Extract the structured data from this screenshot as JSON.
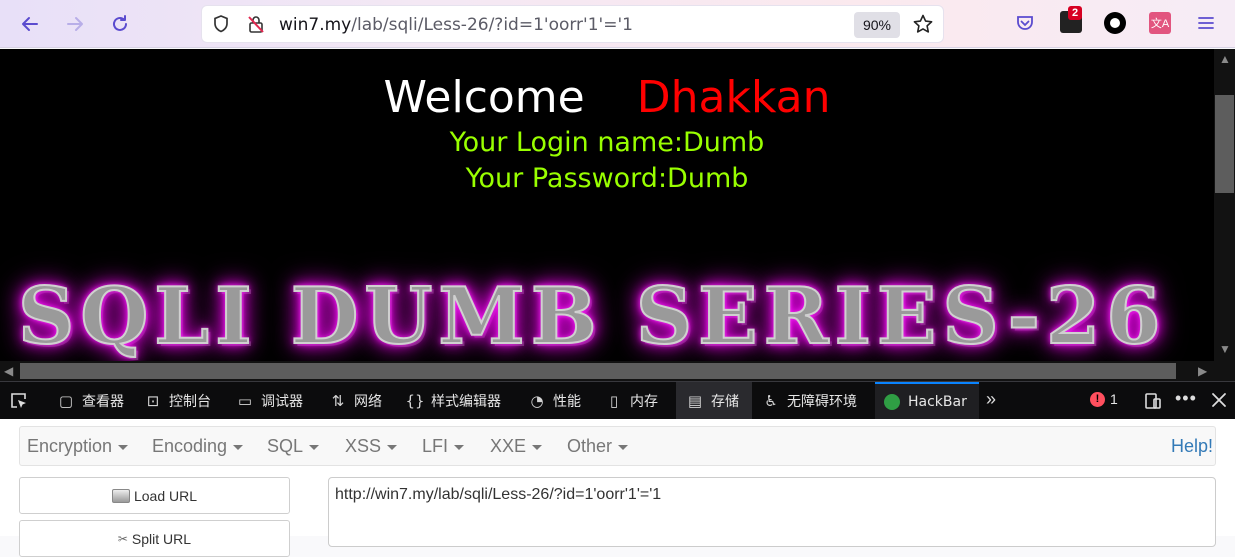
{
  "browser": {
    "url_host": "win7.my",
    "url_path": "/lab/sqli/Less-26/?id=1'oorr'1'='1",
    "zoom": "90%",
    "extension_badge": "2"
  },
  "page": {
    "welcome": "Welcome",
    "username_display": "Dhakkan",
    "login_line": "Your Login name:Dumb",
    "password_line": "Your Password:Dumb",
    "banner": "SQLI DUMB SERIES-26"
  },
  "devtools": {
    "tabs": [
      {
        "label": "查看器",
        "icon": "inspector-icon"
      },
      {
        "label": "控制台",
        "icon": "console-icon"
      },
      {
        "label": "调试器",
        "icon": "debugger-icon"
      },
      {
        "label": "网络",
        "icon": "network-icon"
      },
      {
        "label": "样式编辑器",
        "icon": "style-editor-icon"
      },
      {
        "label": "性能",
        "icon": "performance-icon"
      },
      {
        "label": "内存",
        "icon": "memory-icon"
      },
      {
        "label": "存储",
        "icon": "storage-icon"
      },
      {
        "label": "无障碍环境",
        "icon": "accessibility-icon"
      },
      {
        "label": "HackBar",
        "icon": "hackbar-icon"
      }
    ],
    "error_count": "1"
  },
  "hackbar": {
    "menu": [
      "Encryption",
      "Encoding",
      "SQL",
      "XSS",
      "LFI",
      "XXE",
      "Other"
    ],
    "help": "Help!",
    "load_url": "Load URL",
    "split_url": "Split URL",
    "url_value": "http://win7.my/lab/sqli/Less-26/?id=1'oorr'1'='1"
  },
  "colors": {
    "welcome": "#ffffff",
    "username": "#ff0000",
    "login_text": "#99ff00",
    "banner_glow": "#ee00ee",
    "accent": "#0a84ff"
  }
}
